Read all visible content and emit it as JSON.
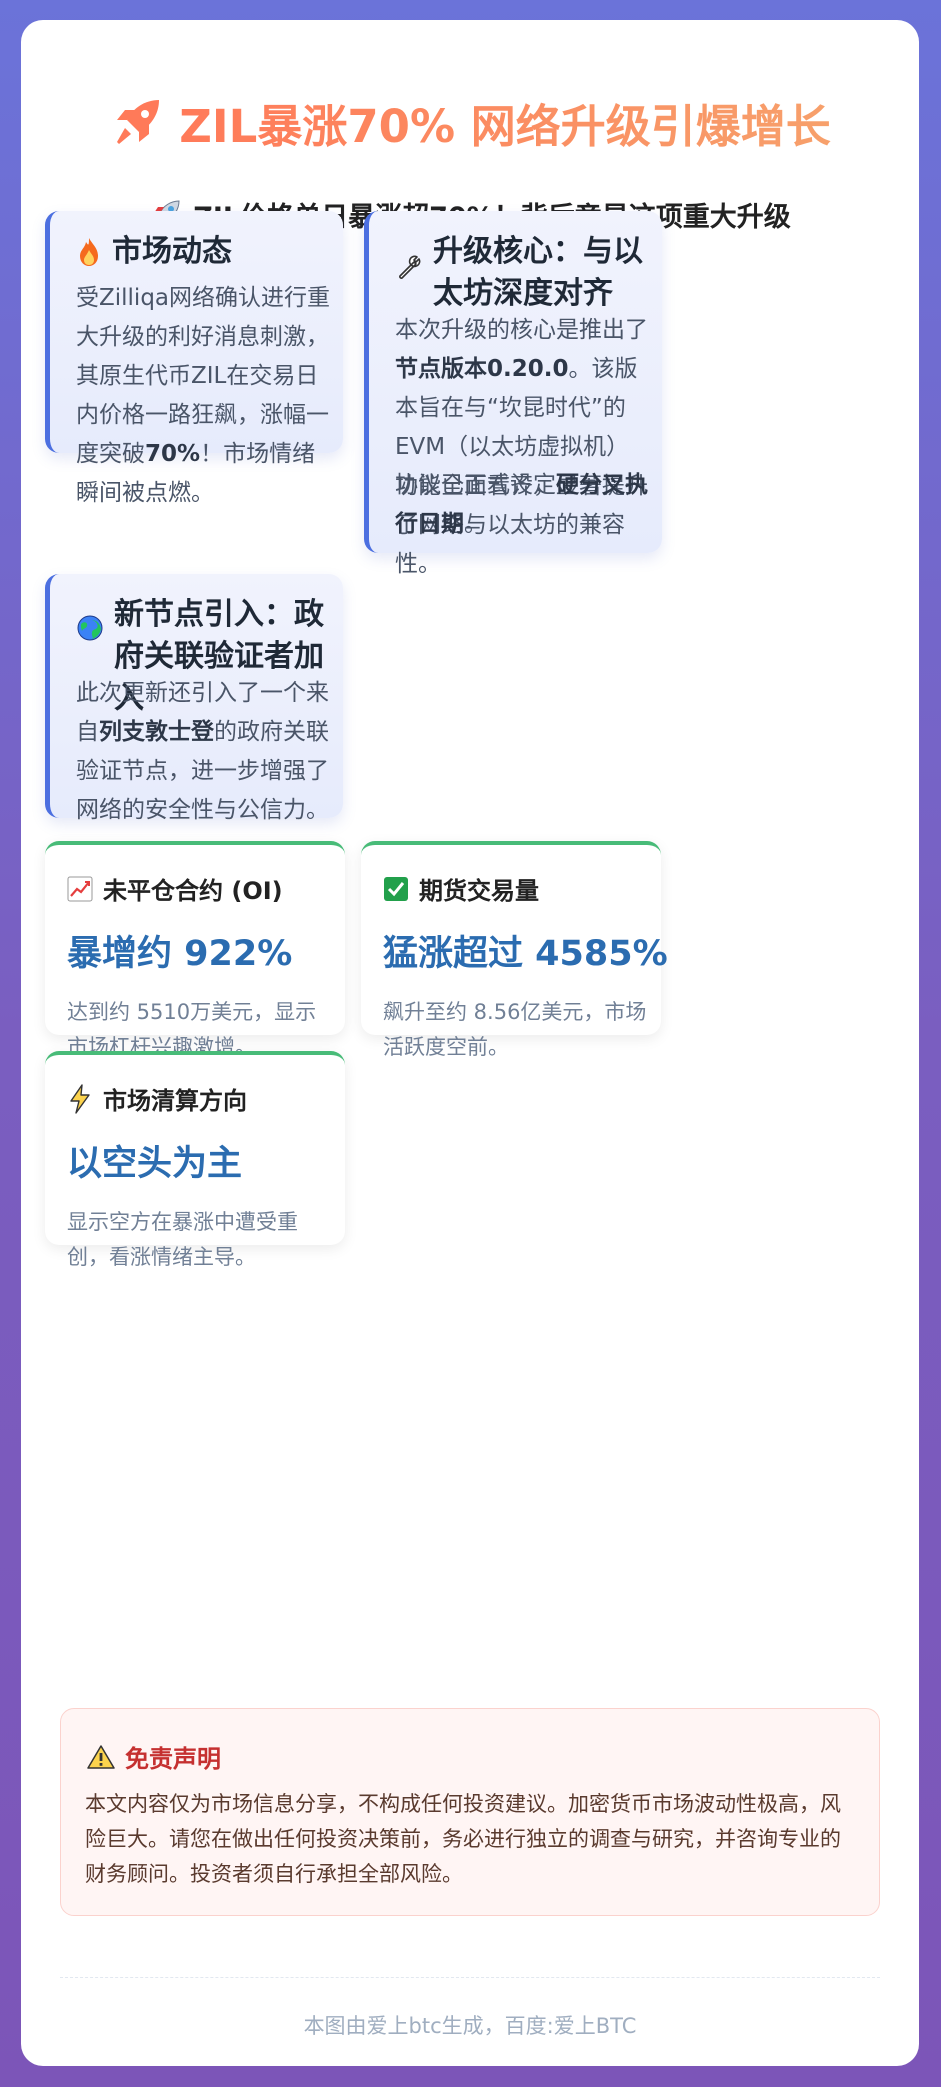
{
  "header": {
    "title": "ZIL暴涨70% 网络升级引爆增长",
    "subtitle": "ZIL价格单日暴涨超70%！背后竟是这项重大升级"
  },
  "sections": {
    "market": {
      "icon": "fire-icon",
      "title": "市场动态",
      "body": [
        {
          "t": "受Zilliqa网络确认进行重大升级的利好消息刺激，其原生代币ZIL在交易日内价格一路狂飙，涨幅一度突破"
        },
        {
          "t": "70%",
          "b": true
        },
        {
          "t": "！市场情绪瞬间被点燃。"
        }
      ]
    },
    "upgrade": {
      "icon": "wrench-icon",
      "title": "升级核心：与以太坊深度对齐",
      "body": [
        {
          "t": "本次升级的核心是推出了"
        },
        {
          "t": "节点版本0.20.0",
          "b": true
        },
        {
          "t": "。该版本旨在与“坎昆时代”的EVM（以太坊虚拟机）功能全面看齐，显著提升了网络与以太坊的兼容性。"
        }
      ],
      "body2": [
        {
          "t": "协议已正式设定"
        },
        {
          "t": "硬分叉执行日期",
          "b": true
        },
        {
          "t": "。"
        }
      ]
    },
    "node": {
      "icon": "globe-icon",
      "title": "新节点引入：政府关联验证者加入",
      "body": [
        {
          "t": "此次更新还引入了一个来自"
        },
        {
          "t": "列支敦士登",
          "b": true
        },
        {
          "t": "的政府关联验证节点，进一步增强了网络的安全性与公信力。"
        }
      ]
    }
  },
  "stats": [
    {
      "icon": "chart-up-icon",
      "label": "未平仓合约 (OI)",
      "value": "暴增约 922%",
      "desc": "达到约 5510万美元，显示市场杠杆兴趣激增。"
    },
    {
      "icon": "check-mark-icon",
      "label": "期货交易量",
      "value": "猛涨超过 4585%",
      "desc": "飙升至约 8.56亿美元，市场活跃度空前。"
    },
    {
      "icon": "lightning-icon",
      "label": "市场清算方向",
      "value": "以空头为主",
      "desc": "显示空方在暴涨中遭受重创，看涨情绪主导。"
    }
  ],
  "disclaimer": {
    "icon": "warning-icon",
    "title": "免责声明",
    "body": "本文内容仅为市场信息分享，不构成任何投资建议。加密货币市场波动性极高，风险巨大。请您在做出任何投资决策前，务必进行独立的调查与研究，并咨询专业的财务顾问。投资者须自行承担全部风险。"
  },
  "footer": "本图由爱上btc生成，百度:爱上BTC",
  "colors": {
    "accent": "#4c6fe0",
    "title": "#ff7a59",
    "stat_value": "#2b6cb0",
    "stat_border": "#48bb78",
    "warning": "#c53030"
  }
}
